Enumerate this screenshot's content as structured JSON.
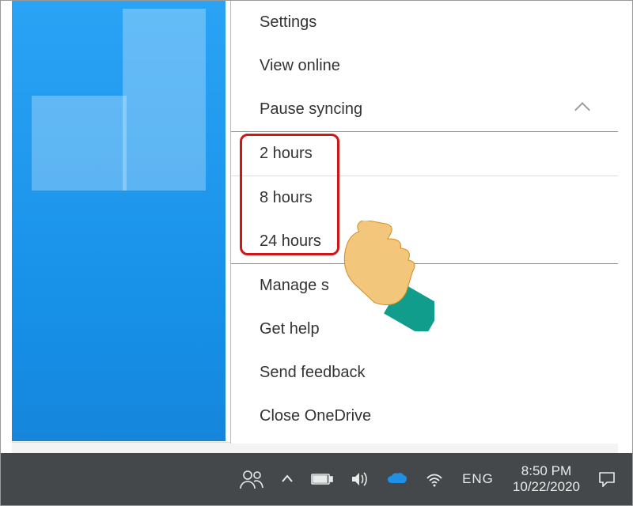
{
  "menu": {
    "settings": "Settings",
    "view_online": "View online",
    "pause": "Pause syncing",
    "pause_options": {
      "h2": "2 hours",
      "h8": "8 hours",
      "h24": "24 hours"
    },
    "manage_storage": "Manage storage",
    "manage_storage_visible": "Manage s",
    "get_help": "Get help",
    "send_feedback": "Send feedback",
    "close": "Close OneDrive"
  },
  "taskbar": {
    "language": "ENG",
    "time": "8:50 PM",
    "date": "10/22/2020"
  }
}
